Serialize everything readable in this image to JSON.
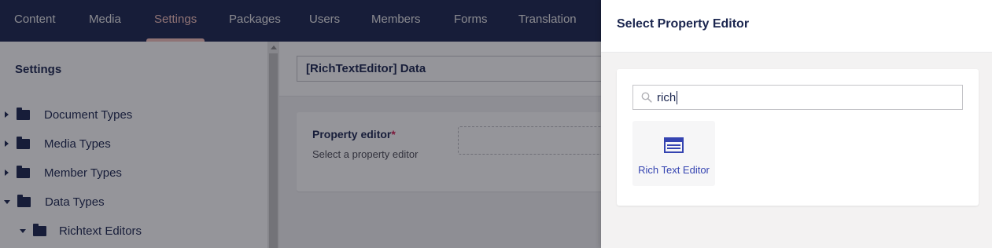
{
  "nav": {
    "items": [
      "Content",
      "Media",
      "Settings",
      "Packages",
      "Users",
      "Members",
      "Forms",
      "Translation"
    ],
    "active": "Settings"
  },
  "tree": {
    "title": "Settings",
    "items": [
      {
        "label": "Document Types",
        "expanded": false
      },
      {
        "label": "Media Types",
        "expanded": false
      },
      {
        "label": "Member Types",
        "expanded": false
      },
      {
        "label": "Data Types",
        "expanded": true
      },
      {
        "label": "Richtext Editors",
        "expanded": true
      }
    ]
  },
  "main": {
    "name_value": "[RichTextEditor] Data",
    "property_label": "Property editor",
    "required_mark": "*",
    "property_description": "Select a property editor"
  },
  "panel": {
    "title": "Select Property Editor",
    "search_value": "rich",
    "result_label": "Rich Text Editor",
    "result_icon": "rich-text-editor-icon"
  },
  "colors": {
    "nav_bg": "#1b264f",
    "active_accent": "#f5c1bc",
    "tile_label": "#3544b1",
    "required": "#d42054"
  }
}
